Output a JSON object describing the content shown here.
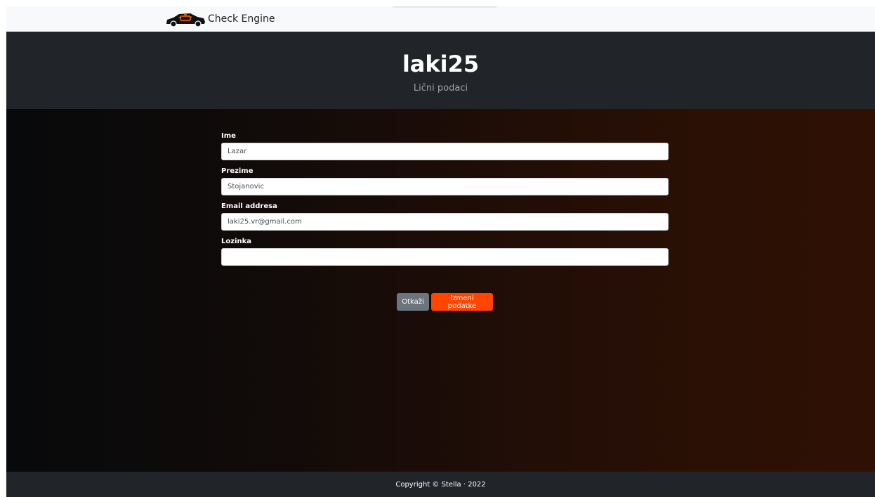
{
  "navbar": {
    "brand_text": "Check Engine",
    "logo_icon": "car-check-engine-icon"
  },
  "header": {
    "title": "laki25",
    "subtitle": "Lični podaci"
  },
  "form": {
    "first_name": {
      "label": "Ime",
      "value": "Lazar"
    },
    "last_name": {
      "label": "Prezime",
      "value": "Stojanovic"
    },
    "email": {
      "label": "Email addresa",
      "value": "laki25.vr@gmail.com"
    },
    "password": {
      "label": "Lozinka",
      "value": ""
    }
  },
  "buttons": {
    "cancel_label": "Otkaži",
    "save_label": "Izmeni podatke"
  },
  "footer": {
    "text": "Copyright © Stella · 2022"
  },
  "colors": {
    "accent": "#ff4500",
    "dark": "#212529",
    "secondary": "#6c757d"
  }
}
